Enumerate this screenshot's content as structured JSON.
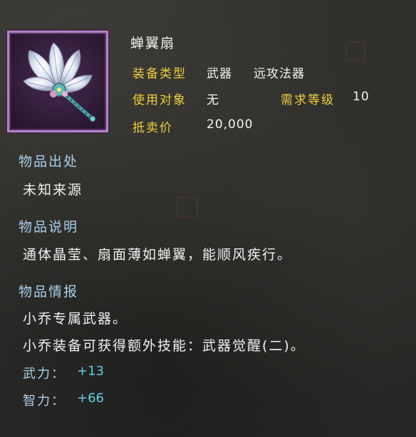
{
  "item": {
    "name": "蝉翼扇",
    "rows": {
      "type_label": "装备类型",
      "type_value": "武器",
      "subtype_value": "远攻法器",
      "target_label": "使用对象",
      "target_value": "无",
      "level_label": "需求等级",
      "level_value": "10",
      "price_label": "抵卖价",
      "price_value": "20,000"
    }
  },
  "sections": {
    "source_title": "物品出处",
    "source_text": "未知来源",
    "desc_title": "物品说明",
    "desc_text": "通体晶莹、扇面薄如蝉翼，能顺风疾行。",
    "info_title": "物品情报",
    "info_line1": "小乔专属武器。",
    "info_line2": "小乔装备可获得额外技能：武器觉醒(二)。"
  },
  "stats": {
    "force_label": "武力：",
    "force_value": "+13",
    "intel_label": "智力：",
    "intel_value": "+66"
  },
  "colors": {
    "label_gold": "#f0cf3a",
    "header_blue": "#a9cfe9",
    "stat_cyan": "#5fcde6",
    "frame_purple": "#b584c7"
  },
  "icons": {
    "item": "cicada-wing-fan-icon"
  }
}
